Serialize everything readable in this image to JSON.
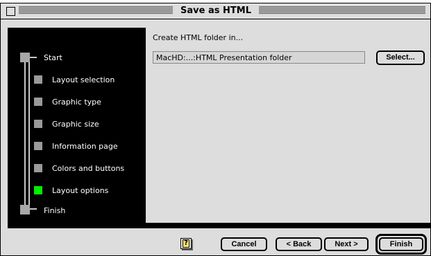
{
  "window": {
    "title": "Save as HTML"
  },
  "sidebar": {
    "start_label": "Start",
    "finish_label": "Finish",
    "steps": [
      {
        "label": "Layout selection"
      },
      {
        "label": "Graphic type"
      },
      {
        "label": "Graphic size"
      },
      {
        "label": "Information page"
      },
      {
        "label": "Colors and buttons"
      },
      {
        "label": "Layout options",
        "active": true
      }
    ]
  },
  "content": {
    "prompt": "Create HTML folder in...",
    "folder_path": "MacHD:...:HTML Presentation folder",
    "select_button": "Select..."
  },
  "footer": {
    "help_glyph": "?",
    "cancel_button": "Cancel",
    "back_button": "< Back",
    "next_button": "Next >",
    "finish_button": "Finish"
  },
  "colors": {
    "window_bg": "#dddddd",
    "sidebar_bg": "#000000",
    "step_marker": "#9a9a9a",
    "active_step_marker": "#00ee00"
  },
  "icons": [
    "close-box-icon",
    "help-icon"
  ]
}
